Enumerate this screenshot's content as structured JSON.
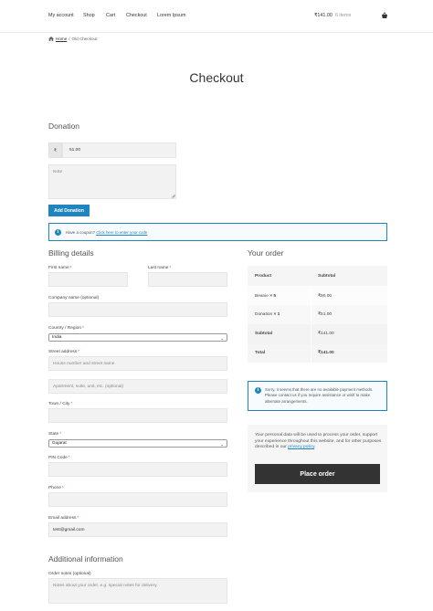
{
  "header": {
    "nav": [
      "My account",
      "Shop",
      "Cart",
      "Checkout",
      "Lorem Ipsum"
    ],
    "cart_total": "₹141.00",
    "cart_count": "6 items"
  },
  "breadcrumb": {
    "home": "Home",
    "sep": "/",
    "current": "Old Checkout"
  },
  "page_title": "Checkout",
  "donation": {
    "heading": "Donation",
    "currency_symbol": "₹",
    "amount": "51.00",
    "note_placeholder": "Note",
    "button": "Add Donation"
  },
  "coupon": {
    "text": "Have a coupon?",
    "link": "Click here to enter your code"
  },
  "billing": {
    "heading": "Billing details",
    "first_name": "First name",
    "last_name": "Last name",
    "company": "Company name (optional)",
    "country_label": "Country / Region",
    "country_value": "India",
    "street_label": "Street address",
    "street_ph1": "House number and street name",
    "street_ph2": "Apartment, suite, unit, etc. (optional)",
    "city_label": "Town / City",
    "state_label": "State",
    "state_value": "Gujarat",
    "pin_label": "PIN Code",
    "phone_label": "Phone",
    "email_label": "Email address",
    "email_value": "test@gmail.com",
    "required_mark": "*"
  },
  "additional": {
    "heading": "Additional information",
    "notes_label": "Order notes (optional)",
    "notes_placeholder": "Notes about your order, e.g. special notes for delivery."
  },
  "order": {
    "heading": "Your order",
    "col_product": "Product",
    "col_subtotal": "Subtotal",
    "items": [
      {
        "name": "Beanie",
        "qty": "× 5",
        "price": "₹90.00"
      },
      {
        "name": "Donation",
        "qty": "× 1",
        "price": "₹51.00"
      }
    ],
    "subtotal_label": "Subtotal",
    "subtotal_value": "₹141.00",
    "total_label": "Total",
    "total_value": "₹141.00"
  },
  "payment_notice": "Sorry, it seems that there are no available payment methods. Please contact us if you require assistance or wish to make alternate arrangements.",
  "privacy": {
    "text": "Your personal data will be used to process your order, support your experience throughout this website, and for other purposes described in our",
    "link": "privacy policy",
    "end": "."
  },
  "place_order": "Place order",
  "colors": {
    "accent": "#1e85be",
    "dark_button": "#333333",
    "required": "#e2401c"
  }
}
